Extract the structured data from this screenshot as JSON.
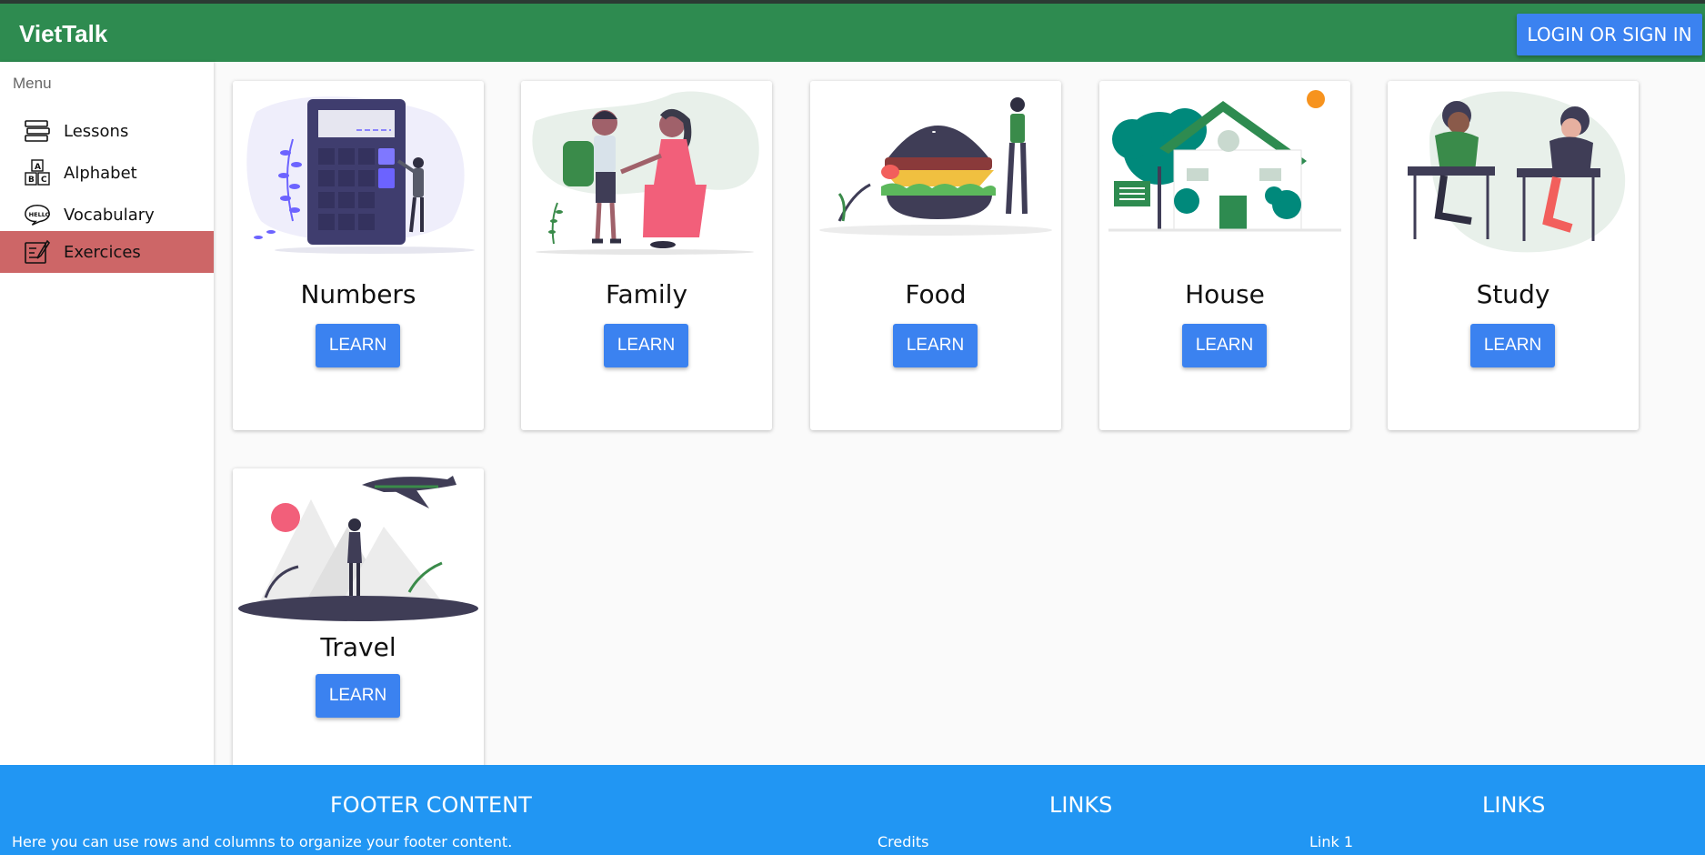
{
  "header": {
    "brand": "VietTalk",
    "login_label": "LOGIN OR SIGN IN",
    "background": "#2e8b50"
  },
  "sidebar": {
    "menu_title": "Menu",
    "items": [
      {
        "label": "Lessons",
        "icon": "books-icon"
      },
      {
        "label": "Alphabet",
        "icon": "abc-blocks-icon"
      },
      {
        "label": "Vocabulary",
        "icon": "speech-bubble-hello-icon"
      },
      {
        "label": "Exercices",
        "icon": "notebook-pencil-icon",
        "active": true
      }
    ],
    "active_color": "#cd6667"
  },
  "cards": [
    {
      "title": "Numbers",
      "button": "LEARN",
      "illustration": "calculator-person-illustration"
    },
    {
      "title": "Family",
      "button": "LEARN",
      "illustration": "mother-child-illustration"
    },
    {
      "title": "Food",
      "button": "LEARN",
      "illustration": "burger-person-illustration"
    },
    {
      "title": "House",
      "button": "LEARN",
      "illustration": "house-trees-illustration"
    },
    {
      "title": "Study",
      "button": "LEARN",
      "illustration": "students-desks-illustration"
    },
    {
      "title": "Travel",
      "button": "LEARN",
      "illustration": "plane-mountains-illustration"
    }
  ],
  "footer": {
    "content_heading": "FOOTER CONTENT",
    "content_text": "Here you can use rows and columns to organize your footer content.",
    "links1_heading": "LINKS",
    "links1_item": "Credits",
    "links2_heading": "LINKS",
    "links2_item": "Link 1",
    "background": "#2196f3"
  }
}
